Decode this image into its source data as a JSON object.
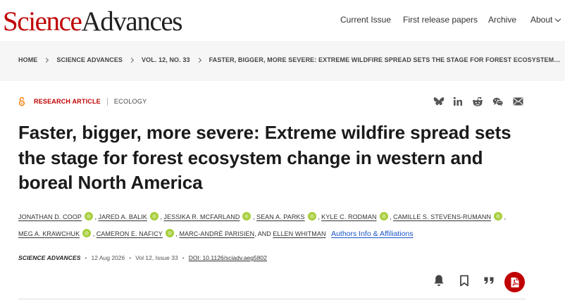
{
  "header": {
    "logo_science": "Science",
    "logo_advances": "Advances",
    "nav": [
      "Current Issue",
      "First release papers",
      "Archive",
      "About"
    ]
  },
  "breadcrumb": [
    "HOME",
    "SCIENCE ADVANCES",
    "VOL. 12, NO. 33",
    "FASTER, BIGGER, MORE SEVERE: EXTREME WILDFIRE SPREAD SETS THE STAGE FOR FOREST ECOSYSTEM…"
  ],
  "article": {
    "type": "RESEARCH ARTICLE",
    "subject": "ECOLOGY",
    "title": "Faster, bigger, more severe: Extreme wildfire spread sets the stage for forest ecosystem change in western and boreal North America",
    "authors": [
      "JONATHAN D. COOP",
      "JARED A. BALIK",
      "JESSIKA R. MCFARLAND",
      "SEAN A. PARKS",
      "KYLE C. RODMAN",
      "CAMILLE S. STEVENS-RUMANN",
      "MEG A. KRAWCHUK",
      "CAMERON E. NAFICY",
      "MARC-ANDRÉ PARISIEN",
      "ELLEN WHITMAN"
    ],
    "author_and": "AND",
    "affiliations_link": "Authors Info & Affiliations",
    "citation": {
      "journal": "SCIENCE ADVANCES",
      "date": "12 Aug 2026",
      "volume": "Vol 12, Issue 33",
      "doi": "DOI: 10.1126/sciadv.aeg5802"
    }
  },
  "share_icons": [
    "bluesky-icon",
    "linkedin-icon",
    "reddit-icon",
    "wechat-icon",
    "email-icon"
  ],
  "action_icons": [
    "bell-icon",
    "bookmark-icon",
    "quote-icon",
    "pdf-icon"
  ],
  "colors": {
    "brand_red": "#c00000",
    "link_blue": "#1a55c8",
    "orcid_green": "#a6ce39",
    "breadcrumb_bg": "#f6f6f6",
    "open_access_orange": "#f68212"
  }
}
